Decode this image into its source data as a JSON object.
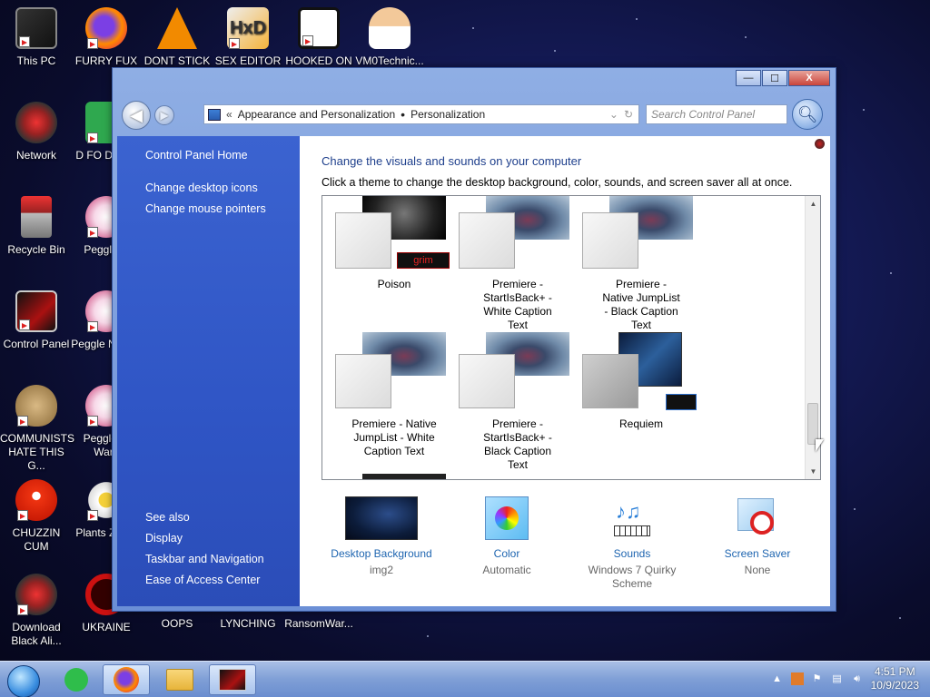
{
  "desktop": {
    "icons": [
      {
        "label": "This PC"
      },
      {
        "label": "FURRY FUX"
      },
      {
        "label": "DONT STICK"
      },
      {
        "label": "SEX EDITOR"
      },
      {
        "label": "HOOKED ON"
      },
      {
        "label": "VM0Technic..."
      },
      {
        "label": "Network"
      },
      {
        "label": "D FO DUMB"
      },
      {
        "label": "Recycle Bin"
      },
      {
        "label": "Peggle D"
      },
      {
        "label": "Control Panel"
      },
      {
        "label": "Peggle N Delu"
      },
      {
        "label": "COMMUNISTS HATE THIS G..."
      },
      {
        "label": "Peggle of Warc"
      },
      {
        "label": "CHUZZIN CUM"
      },
      {
        "label": "Plants Zomb"
      },
      {
        "label": "Download Black Ali..."
      },
      {
        "label": "UKRAINE"
      },
      {
        "label": "OOPS"
      },
      {
        "label": "LYNCHING"
      },
      {
        "label": "RansomWar..."
      }
    ]
  },
  "window": {
    "controls": {
      "minimize": "—",
      "maximize": "☐",
      "close": "X"
    },
    "address": {
      "chevron": "«",
      "segment1": "Appearance and Personalization",
      "separator": "•",
      "segment2": "Personalization"
    },
    "search_placeholder": "Search Control Panel",
    "left_pane": {
      "home": "Control Panel Home",
      "links": [
        "Change desktop icons",
        "Change mouse pointers"
      ],
      "see_also_title": "See also",
      "see_also": [
        "Display",
        "Taskbar and Navigation",
        "Ease of Access Center"
      ]
    },
    "main": {
      "heading": "Change the visuals and sounds on your computer",
      "subtitle": "Click a theme to change the desktop background, color, sounds, and screen saver all at once.",
      "themes": [
        {
          "name": "Poison",
          "tile": "grim"
        },
        {
          "name": "Premiere - StartIsBack+ - White Caption Text"
        },
        {
          "name": "Premiere - Native JumpList - Black Caption Text"
        },
        {
          "name": "Premiere - Native JumpList - White Caption Text"
        },
        {
          "name": "Premiere - StartIsBack+ - Black Caption Text"
        },
        {
          "name": "Requiem"
        }
      ],
      "bottom": [
        {
          "label": "Desktop Background",
          "value": "img2"
        },
        {
          "label": "Color",
          "value": "Automatic"
        },
        {
          "label": "Sounds",
          "value": "Windows 7 Quirky Scheme"
        },
        {
          "label": "Screen Saver",
          "value": "None"
        }
      ]
    }
  },
  "taskbar": {
    "time": "4:51 PM",
    "date": "10/9/2023"
  }
}
